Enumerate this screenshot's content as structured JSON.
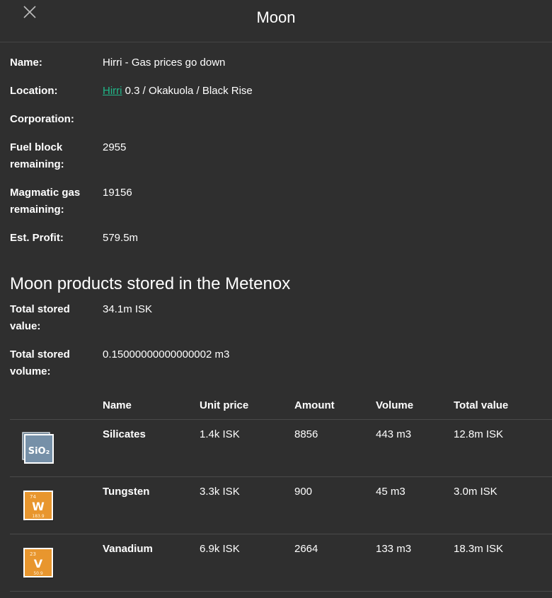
{
  "header": {
    "title": "Moon"
  },
  "details": {
    "name_label": "Name:",
    "name_value": "Hirri - Gas prices go down",
    "location_label": "Location:",
    "location_link": "Hirri",
    "location_rest": " 0.3 / Okakuola / Black Rise",
    "corporation_label": "Corporation:",
    "corporation_value": "",
    "fuel_label": "Fuel block remaining:",
    "fuel_value": "2955",
    "gas_label": "Magmatic gas remaining:",
    "gas_value": "19156",
    "profit_label": "Est. Profit:",
    "profit_value": "579.5m"
  },
  "storage": {
    "title": "Moon products stored in the Metenox",
    "total_value_label": "Total stored value:",
    "total_value": "34.1m ISK",
    "total_volume_label": "Total stored volume:",
    "total_volume": "0.15000000000000002 m3"
  },
  "table": {
    "columns": [
      "Name",
      "Unit price",
      "Amount",
      "Volume",
      "Total value"
    ],
    "rows": [
      {
        "name": "Silicates",
        "unit_price": "1.4k ISK",
        "amount": "8856",
        "volume": "443 m3",
        "total": "12.8m ISK",
        "icon": "silicates-icon",
        "symbol": "SiO₂"
      },
      {
        "name": "Tungsten",
        "unit_price": "3.3k ISK",
        "amount": "900",
        "volume": "45 m3",
        "total": "3.0m ISK",
        "icon": "tungsten-icon",
        "symbol": "W",
        "number": "74",
        "mass": "183.9"
      },
      {
        "name": "Vanadium",
        "unit_price": "6.9k ISK",
        "amount": "2664",
        "volume": "133 m3",
        "total": "18.3m ISK",
        "icon": "vanadium-icon",
        "symbol": "V",
        "number": "23",
        "mass": "50.9"
      }
    ]
  },
  "colors": {
    "background": "#2f2f2f",
    "link": "#20b98a",
    "element_orange": "#e8962e",
    "silicate_blue": "#6e8aa3"
  }
}
